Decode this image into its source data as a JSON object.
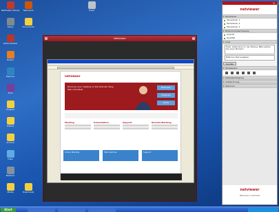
{
  "desktop": {
    "icons": [
      {
        "label": "NetViewer Manager",
        "color": "#c0392b"
      },
      {
        "label": "Teamwork",
        "color": "#d35400"
      },
      {
        "label": "Trash",
        "color": "#bdc3c7"
      },
      {
        "label": "Setup",
        "color": "#7f8c8d"
      },
      {
        "label": "Documents",
        "color": "#f4d03f"
      },
      {
        "label": "Adobe Reader",
        "color": "#b03a2e"
      },
      {
        "label": "Firefox",
        "color": "#e67e22"
      },
      {
        "label": "Explorer",
        "color": "#2e86c1"
      },
      {
        "label": "Tools",
        "color": "#7d3c98"
      },
      {
        "label": "Projects",
        "color": "#f4d03f"
      },
      {
        "label": "Shared",
        "color": "#f4d03f"
      },
      {
        "label": "Archive",
        "color": "#f4d03f"
      },
      {
        "label": "Data",
        "color": "#5dade2"
      },
      {
        "label": "Network",
        "color": "#85929e"
      },
      {
        "label": "Media",
        "color": "#f4d03f"
      },
      {
        "label": "Downloads",
        "color": "#f4d03f"
      }
    ]
  },
  "taskbar": {
    "start_label": "Start"
  },
  "viewer": {
    "title": "Netviewer",
    "browser": {
      "title": "",
      "menu": [
        "Datei",
        "Bearbeiten",
        "Ansicht",
        "Favoriten",
        "Extras",
        "?"
      ]
    },
    "site": {
      "logo": "netviewer",
      "hero_text": "Discover your meeting on the Internet. Easy, fast, individual.",
      "hero_buttons": [
        "Netviewer",
        "Kostenlos",
        "Demo"
      ],
      "columns": [
        {
          "heading": "Meeting"
        },
        {
          "heading": "Präsentation"
        },
        {
          "heading": "Support"
        },
        {
          "heading": "Remote-Wartung"
        }
      ],
      "tiles": [
        "Online Meeting",
        "Web-Seminar",
        "Support"
      ]
    }
  },
  "panel": {
    "logo": "netviewer",
    "sections": [
      {
        "title": "Teilnehmer",
        "rows": [
          "Teilnehmer 1",
          "Teilnehmer 2",
          "Teilnehmer 3"
        ]
      },
      {
        "title": "Bildschirmübertragung",
        "rows": [
          "Ansicht",
          "Qualität"
        ]
      },
      {
        "title": "Chat",
        "rows": []
      },
      {
        "title": "Whiteboard",
        "rows": []
      },
      {
        "title": "Dateiübertragung",
        "rows": []
      },
      {
        "title": "Aufzeichnung",
        "rows": []
      },
      {
        "title": "Optionen",
        "rows": []
      }
    ],
    "chat_text": "Hallo, willkommen in der Sitzung. Bitte warten Sie einen Moment.",
    "chat_input": "Bitte hier Text eingeben",
    "send_label": "Senden",
    "footer_logo": "netviewer",
    "footer_text": "Netviewer one2meet"
  }
}
